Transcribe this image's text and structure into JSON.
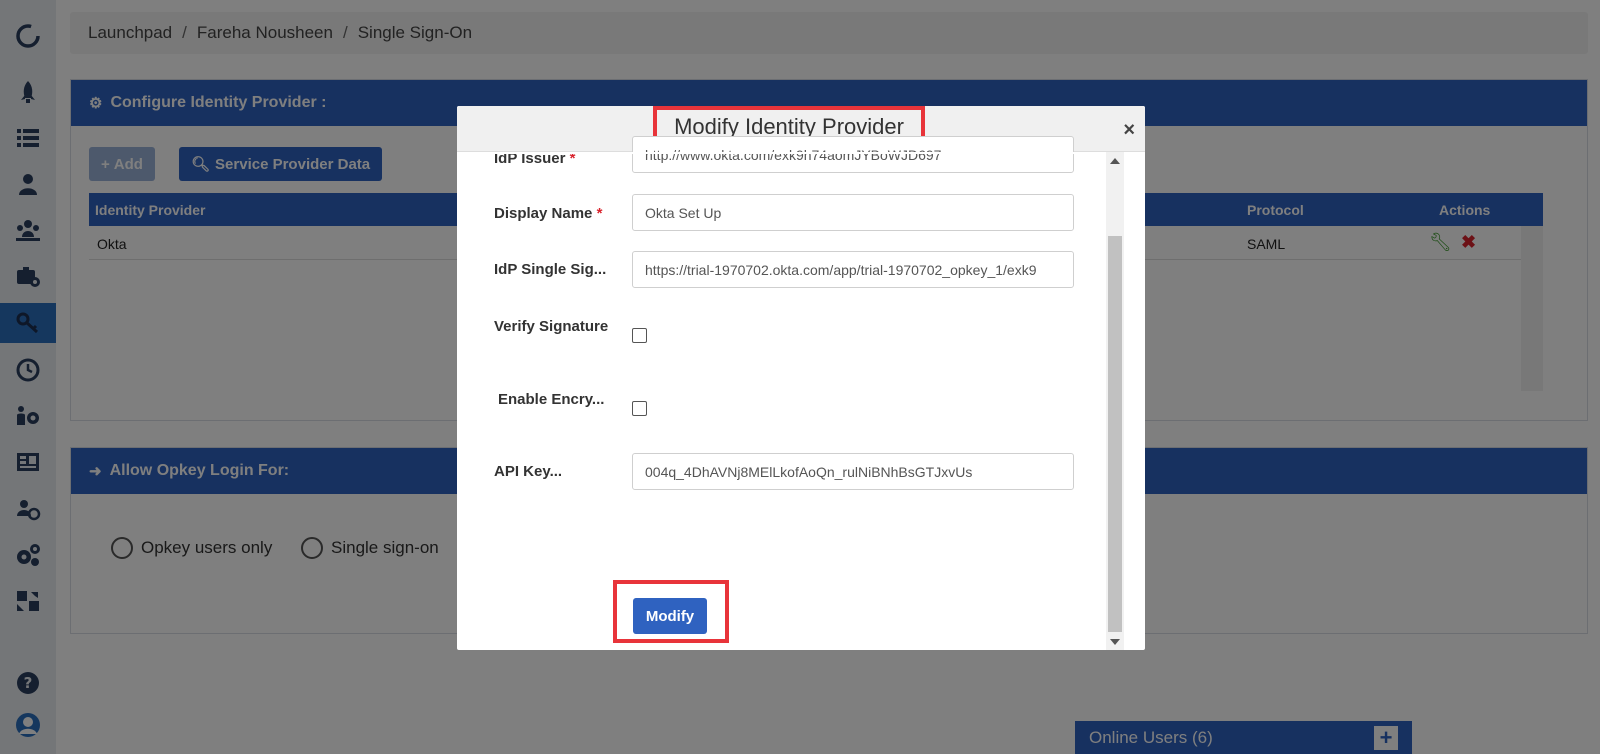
{
  "breadcrumb": [
    "Launchpad",
    "Fareha Nousheen",
    "Single Sign-On"
  ],
  "configure_panel": {
    "title": "Configure Identity Provider :",
    "add_label": "Add",
    "spd_label": "Service Provider Data",
    "columns": [
      "Identity Provider",
      "Protocol",
      "Actions"
    ],
    "rows": [
      {
        "identity_provider": "Okta",
        "protocol": "SAML"
      }
    ]
  },
  "login_panel": {
    "title": "Allow Opkey Login For:",
    "options": [
      "Opkey users only",
      "Single sign-on"
    ]
  },
  "online_users": "Online Users (6)",
  "modal": {
    "title": "Modify Identity Provider",
    "close": "×",
    "fields": {
      "idp_issuer": {
        "label": "IdP Issuer",
        "value": "http://www.okta.com/exk9h74aomJYBoWJD697"
      },
      "display_name": {
        "label": "Display Name",
        "value": "Okta Set Up"
      },
      "idp_sso": {
        "label": "IdP Single Sig...",
        "value": "https://trial-1970702.okta.com/app/trial-1970702_opkey_1/exk9"
      },
      "verify_signature": {
        "label": "Verify Signature",
        "checked": false
      },
      "enable_encryption": {
        "label": "Enable Encry...",
        "checked": false
      },
      "api_key": {
        "label": "API Key...",
        "value": "004q_4DhAVNj8MElLkofAoQn_rulNiBNhBsGTJxvUs"
      }
    },
    "required_mark": "*",
    "modify_label": "Modify"
  },
  "colors": {
    "brand": "#2f62c0",
    "highlight": "#e8343a",
    "overlay": "rgba(0,0,0,0.5)"
  },
  "sidebar_icons": [
    "logo-icon",
    "rocket-icon",
    "list-icon",
    "user-icon",
    "team-icon",
    "briefcase-settings-icon",
    "key-icon",
    "clock-icon",
    "users-settings-icon",
    "dashboard-icon",
    "user-sync-icon",
    "gears-icon",
    "transfer-icon",
    "help-icon",
    "avatar-icon"
  ]
}
